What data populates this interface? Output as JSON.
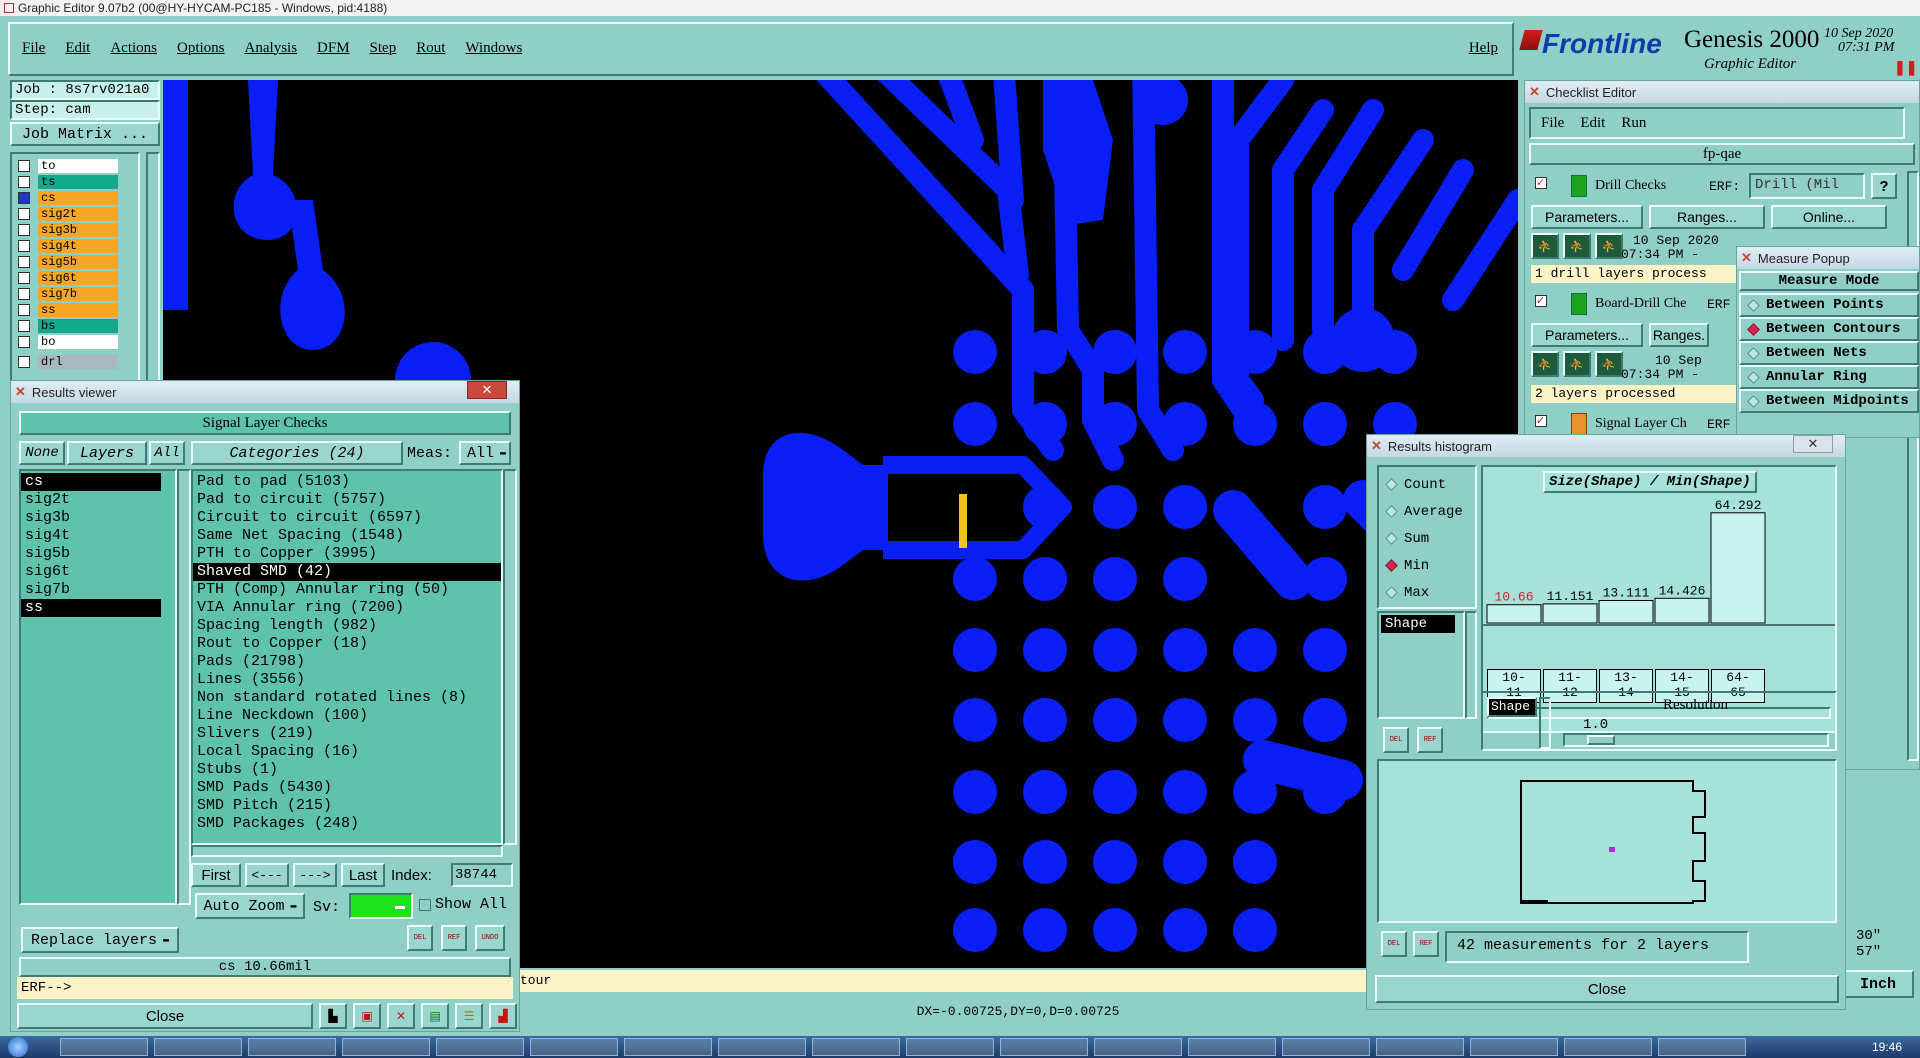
{
  "window": {
    "title": "Graphic Editor 9.07b2 (00@HY-HYCAM-PC185 - Windows, pid:4188)"
  },
  "menu": {
    "items": [
      "File",
      "Edit",
      "Actions",
      "Options",
      "Analysis",
      "DFM",
      "Step",
      "Rout",
      "Windows"
    ],
    "help": "Help"
  },
  "brand": {
    "logo": "Frontline",
    "product": "Genesis 2000",
    "subtitle": "Graphic Editor",
    "date": "10 Sep 2020",
    "time": "07:31 PM"
  },
  "job": {
    "job_label": "Job : 8s7rv021a0",
    "step_label": "Step: cam",
    "matrix_button": "Job Matrix ..."
  },
  "layers": [
    {
      "name": "to",
      "color": "#ffffff"
    },
    {
      "name": "ts",
      "color": "#12a88a"
    },
    {
      "name": "cs",
      "color": "#f6a524"
    },
    {
      "name": "sig2t",
      "color": "#f6a524"
    },
    {
      "name": "sig3b",
      "color": "#f6a524"
    },
    {
      "name": "sig4t",
      "color": "#f6a524"
    },
    {
      "name": "sig5b",
      "color": "#f6a524"
    },
    {
      "name": "sig6t",
      "color": "#f6a524"
    },
    {
      "name": "sig7b",
      "color": "#f6a524"
    },
    {
      "name": "ss",
      "color": "#f6a524"
    },
    {
      "name": "bs",
      "color": "#12a88a"
    },
    {
      "name": "bo",
      "color": "#ffffff"
    },
    {
      "name": "drl",
      "color": "#a8b8bc"
    }
  ],
  "results_viewer": {
    "title": "Results viewer",
    "header": "Signal Layer Checks",
    "none_btn": "None",
    "layers_btn": "Layers",
    "all_btn": "All",
    "categories_btn": "Categories (24)",
    "meas_label": "Meas:",
    "meas_value": "All",
    "layer_list": [
      "cs",
      "sig2t",
      "sig3b",
      "sig4t",
      "sig5b",
      "sig6t",
      "sig7b",
      "ss"
    ],
    "categories": [
      "Pad to pad (5103)",
      "Pad to circuit (5757)",
      "Circuit to circuit (6597)",
      "Same Net Spacing (1548)",
      "PTH to Copper (3995)",
      "Shaved SMD (42)",
      "PTH (Comp) Annular ring (50)",
      "VIA Annular ring (7200)",
      "Spacing length (982)",
      "Rout to Copper (18)",
      "Pads (21798)",
      "Lines (3556)",
      "Non standard rotated lines (8)",
      "Line Neckdown (100)",
      "Slivers (219)",
      "Local Spacing (16)",
      "Stubs (1)",
      "SMD Pads (5430)",
      "SMD Pitch (215)",
      "SMD Packages (248)"
    ],
    "first_btn": "First",
    "prev_btn": "<---",
    "next_btn": "--->",
    "last_btn": "Last",
    "index_label": "Index:",
    "index_value": "38744",
    "auto_zoom": "Auto Zoom",
    "sv_label": "Sv:",
    "show_all": "Show All",
    "replace_layers": "Replace layers",
    "status": "cs 10.66mil",
    "erf_prompt": "ERF-->",
    "close": "Close",
    "mini_del": "DEL",
    "mini_ref": "REF",
    "mini_undo": "UNDO"
  },
  "checklist": {
    "title": "Checklist Editor",
    "menu": [
      "File",
      "Edit",
      "Run"
    ],
    "name": "fp-qae",
    "items": [
      {
        "name": "Drill Checks",
        "erf_label": "ERF:",
        "erf_value": "Drill (Mil",
        "date": "10 Sep 2020",
        "time": "07:34 PM -",
        "summary": "1 drill layers process"
      },
      {
        "name": "Board-Drill Che",
        "erf_label": "ERF",
        "date": "10 Sep",
        "time": "07:34 PM -",
        "summary": "2 layers processed"
      },
      {
        "name": "Signal Layer Ch",
        "erf_label": "ERF"
      }
    ],
    "params": "Parameters...",
    "ranges": "Ranges...",
    "ranges_short": "Ranges.",
    "online": "Online...",
    "help": "?"
  },
  "measure": {
    "title": "Measure Popup",
    "header": "Measure Mode",
    "modes": [
      {
        "label": "Between Points",
        "on": false
      },
      {
        "label": "Between Contours",
        "on": true
      },
      {
        "label": "Between Nets",
        "on": false
      },
      {
        "label": "Annular Ring",
        "on": false
      },
      {
        "label": "Between Midpoints",
        "on": false
      }
    ]
  },
  "histogram": {
    "title": "Results histogram",
    "stats": [
      {
        "label": "Count",
        "on": false
      },
      {
        "label": "Average",
        "on": false
      },
      {
        "label": "Sum",
        "on": false
      },
      {
        "label": "Min",
        "on": true
      },
      {
        "label": "Max",
        "on": false
      }
    ],
    "shape_list": [
      "Shape"
    ],
    "chart_title": "Size(Shape) / Min(Shape)",
    "resolution_label": "Resolution",
    "resolution_value": "1.0",
    "shape_tag": "Shape",
    "footer": "42 measurements for 2 layers",
    "close": "Close",
    "del": "DEL",
    "ref": "REF"
  },
  "chart_data": {
    "type": "bar",
    "title": "Size(Shape) / Min(Shape)",
    "categories": [
      "10-\n11",
      "11-\n12",
      "13-\n14",
      "14-\n15",
      "64-\n65"
    ],
    "category_lines": [
      [
        "10-",
        "11"
      ],
      [
        "11-",
        "12"
      ],
      [
        "13-",
        "14"
      ],
      [
        "14-",
        "15"
      ],
      [
        "64-",
        "65"
      ]
    ],
    "values": [
      10.66,
      11.151,
      13.111,
      14.426,
      64.292
    ],
    "value_labels": [
      "10.66",
      "11.151",
      "13.111",
      "14.426",
      "64.292"
    ],
    "ylim": [
      0,
      70
    ],
    "highlight_color": "#d81f2b"
  },
  "canvas": {
    "bottom_text": "tour",
    "coords": "DX=-0.00725,DY=0,D=0.00725",
    "unit": "Inch",
    "side_a": "30\"",
    "side_b": "57\""
  },
  "taskbar": {
    "clock": "19:46"
  },
  "colors": {
    "copper": "#0a1ff7",
    "background": "#000000",
    "panel": "#8fcfc6",
    "list": "#5fc2ab",
    "highlight": "#f0c419"
  }
}
